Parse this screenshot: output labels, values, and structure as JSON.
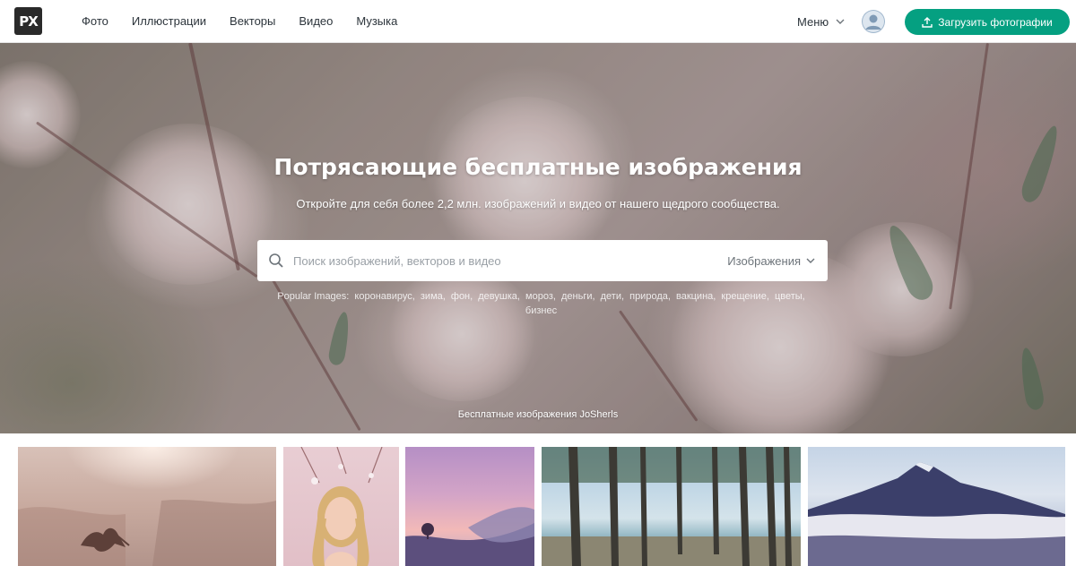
{
  "header": {
    "logo_text": "PX",
    "nav": [
      "Фото",
      "Иллюстрации",
      "Векторы",
      "Видео",
      "Музыка"
    ],
    "menu_label": "Меню",
    "upload_label": "Загрузить фотографии",
    "accent_color": "#05a081"
  },
  "hero": {
    "title": "Потрясающие бесплатные изображения",
    "subtitle": "Откройте для себя более 2,2 млн. изображений и видео от нашего щедрого сообщества.",
    "search": {
      "placeholder": "Поиск изображений, векторов и видео",
      "type_label": "Изображения"
    },
    "popular_label": "Popular Images:",
    "popular_tags": [
      "коронавирус,",
      "зима,",
      "фон,",
      "девушка,",
      "мороз,",
      "деньги,",
      "дети,",
      "природа,",
      "вакцина,",
      "крещение,",
      "цветы,",
      "бизнес"
    ],
    "credit": "Бесплатные изображения JoSherls"
  },
  "icons": {
    "search": "search-icon",
    "chevron": "chevron-down-icon",
    "upload": "upload-icon",
    "user": "user-icon"
  }
}
